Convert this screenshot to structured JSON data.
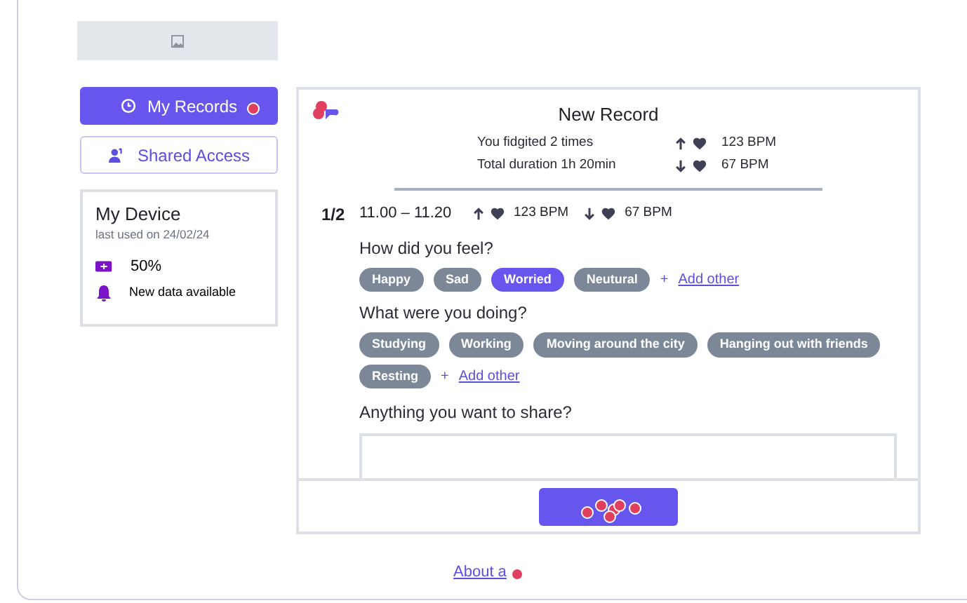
{
  "sidebar": {
    "items": [
      {
        "label": "My Records",
        "selected": true,
        "kind": "records"
      },
      {
        "label": "Shared Access",
        "selected": false,
        "kind": "shared"
      }
    ],
    "device": {
      "title": "My Device",
      "last_used": "last used on 24/02/24",
      "battery": "50%",
      "notice": "New data available"
    }
  },
  "record": {
    "title": "New Record",
    "summary": [
      {
        "text": "You fidgited 2 times",
        "kind": "high",
        "reading": "123 BPM"
      },
      {
        "text": "Total duration 1h 20min",
        "kind": "low",
        "reading": "67 BPM"
      }
    ],
    "segment": {
      "index": "1/2",
      "time": "11.00 – 11.20",
      "high": "123 BPM",
      "low": "67 BPM"
    },
    "questions": [
      {
        "label": "How did you feel?",
        "options": [
          {
            "label": "Happy",
            "selected": false
          },
          {
            "label": "Sad",
            "selected": false
          },
          {
            "label": "Worried",
            "selected": true
          },
          {
            "label": "Neutural",
            "selected": false
          }
        ],
        "add": "Add other",
        "add_icon": "+"
      },
      {
        "label": "What were you doing?",
        "options": [
          {
            "label": "Studying",
            "selected": false
          },
          {
            "label": "Working",
            "selected": false
          },
          {
            "label": "Moving around the city",
            "selected": false
          },
          {
            "label": "Hanging out with friends",
            "selected": false
          },
          {
            "label": "Resting",
            "selected": false
          }
        ],
        "add": "Add other",
        "add_icon": "+"
      }
    ],
    "share_label": "Anything you want to share?"
  },
  "footer_link": "About a"
}
